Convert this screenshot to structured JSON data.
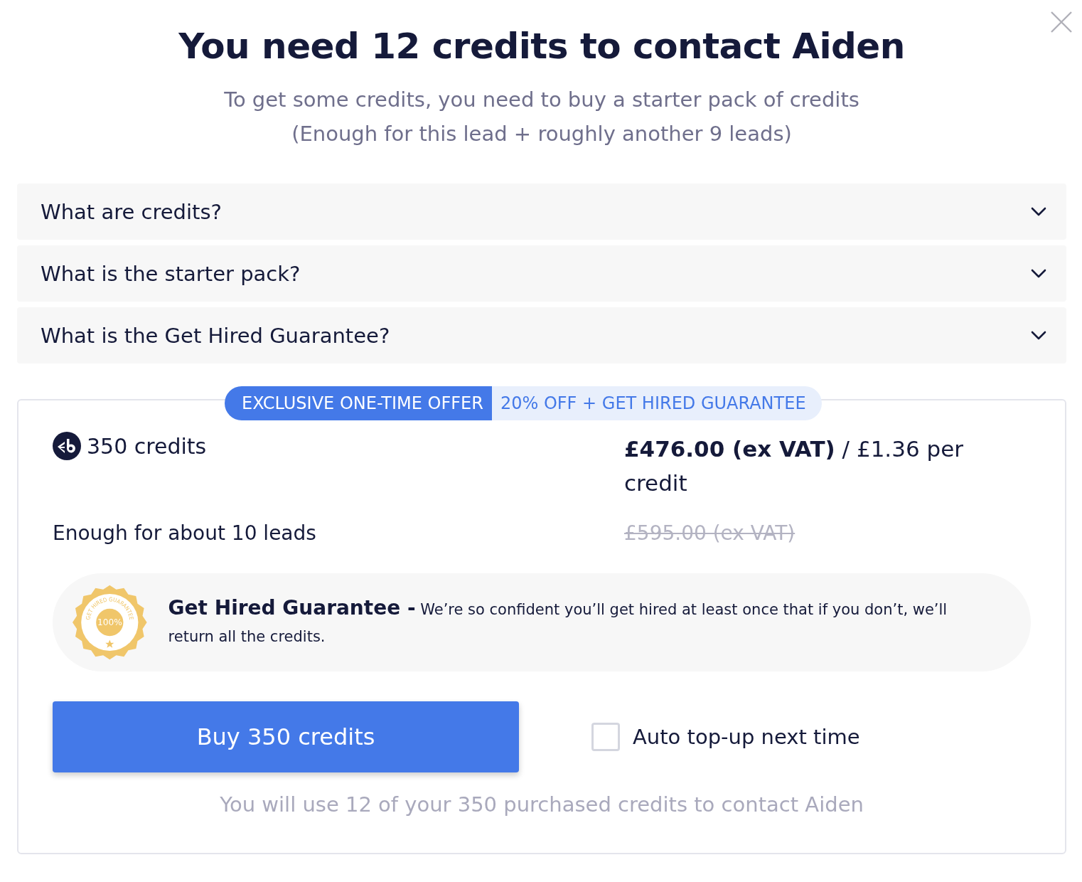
{
  "title": "You need 12 credits to contact Aiden",
  "subtitle": [
    "To get some credits, you need to buy a starter pack of credits",
    "(Enough for this lead + roughly another 9 leads)"
  ],
  "faq": [
    {
      "question": "What are credits?",
      "expanded": false
    },
    {
      "question": "What is the starter pack?",
      "expanded": false
    },
    {
      "question": "What is the Get Hired Guarantee?",
      "expanded": false
    }
  ],
  "offer": {
    "tag": "EXCLUSIVE ONE-TIME OFFER",
    "tag_detail": "20% OFF + GET HIRED GUARANTEE",
    "credits": "350 credits",
    "price": "**£476.00 (ex VAT)** / £1.36 per credit",
    "note": "Enough for about 10 leads",
    "old_price": "£595.00 (ex VAT)",
    "seal": {
      "arc_text": "GET HIRED GUARANTEE",
      "center": "100%"
    },
    "guarantee": "**Get Hired Guarantee -** We’re so confident you’ll get hired at least once that if you don’t, we’ll return all the credits.",
    "buy_button": "Buy 350 credits",
    "auto_topup": {
      "label": "Auto top-up next time",
      "checked": false
    },
    "footnote": "You will use 12 of your 350 purchased credits to contact Aiden"
  }
}
